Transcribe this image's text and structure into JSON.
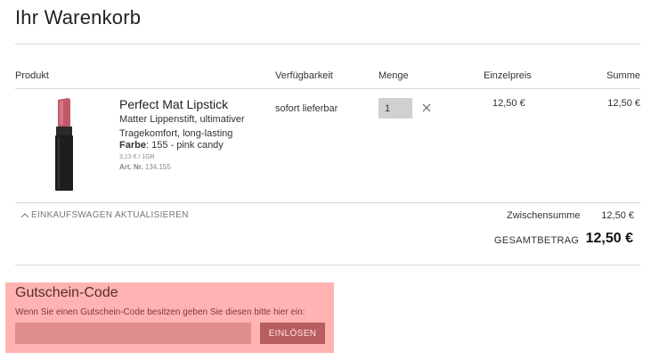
{
  "cart": {
    "title": "Ihr Warenkorb"
  },
  "columns": {
    "product": "Produkt",
    "availability": "Verfügbarkeit",
    "quantity": "Menge",
    "unit_price": "Einzelpreis",
    "sum": "Summe"
  },
  "items": [
    {
      "name": "Perfect Mat Lipstick",
      "description": "Matter Lippenstift, ultimativer Tragekomfort, long-lasting",
      "color_label": "Farbe",
      "color_value": ": 155 - pink candy",
      "base_price": "3,13 € / 1GR",
      "article_label": "Art. Nr.",
      "article_value": " 134.155",
      "availability": "sofort lieferbar",
      "quantity": "1",
      "unit_price": "12,50 €",
      "sum": "12,50 €",
      "lipstick_color": "#c05a6a",
      "case_color": "#1e1e1e"
    }
  ],
  "actions": {
    "update_cart": "EINKAUFSWAGEN AKTUALISIEREN"
  },
  "totals": {
    "subtotal_label": "Zwischensumme",
    "subtotal_value": "12,50 €",
    "total_label": "GESAMTBETRAG",
    "total_value": "12,50 €"
  },
  "coupon": {
    "title": "Gutschein-Code",
    "hint": "Wenn Sie einen Gutschein-Code besitzen geben Sie diesen bitte hier ein:",
    "input_value": "",
    "button_label": "EINLÖSEN",
    "background_color": "#ffb3b3"
  },
  "icons": {
    "remove": "close-icon",
    "update": "chevron-up-icon"
  }
}
